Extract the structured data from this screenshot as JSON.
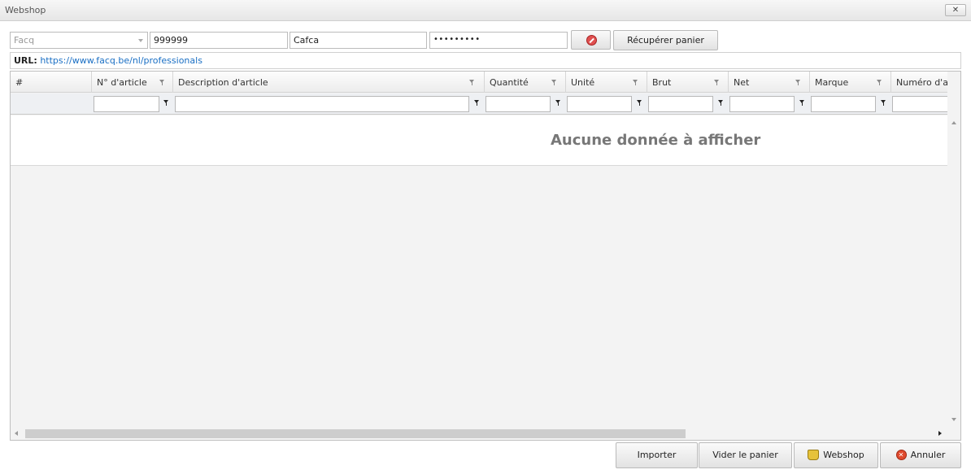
{
  "window": {
    "title": "Webshop",
    "close_label": "✕"
  },
  "form": {
    "supplier_value": "Facq",
    "customer_number": "999999",
    "username": "Cafca",
    "password": "•••••••••",
    "fetch_button": "Récupérer panier"
  },
  "url": {
    "label": "URL:",
    "value": "https://www.facq.be/nl/professionals"
  },
  "grid": {
    "columns": [
      {
        "key": "row",
        "label": "#"
      },
      {
        "key": "article_no",
        "label": "N° d'article"
      },
      {
        "key": "description",
        "label": "Description d'article"
      },
      {
        "key": "quantity",
        "label": "Quantité"
      },
      {
        "key": "unit",
        "label": "Unité"
      },
      {
        "key": "gross",
        "label": "Brut"
      },
      {
        "key": "net",
        "label": "Net"
      },
      {
        "key": "brand",
        "label": "Marque"
      },
      {
        "key": "number",
        "label": "Numéro d'a"
      }
    ],
    "empty_message": "Aucune donnée à afficher"
  },
  "footer": {
    "import": "Importer",
    "clear_cart": "Vider le panier",
    "webshop": "Webshop",
    "cancel": "Annuler"
  },
  "colors": {
    "link": "#1a6fc4",
    "empty_text": "#777777"
  }
}
